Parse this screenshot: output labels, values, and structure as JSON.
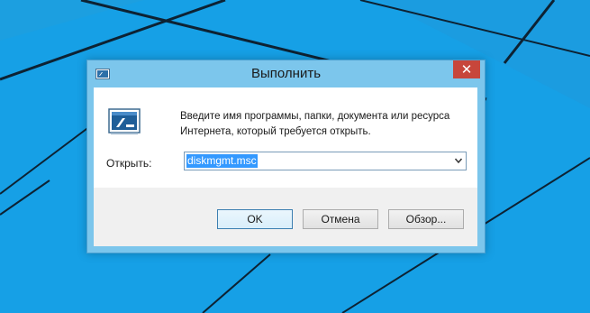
{
  "window": {
    "title": "Выполнить",
    "close_glyph": "✕"
  },
  "dialog": {
    "description": "Введите имя программы, папки, документа или ресурса Интернета, который требуется открыть.",
    "open_label": "Открыть:",
    "command_value": "diskmgmt.msc"
  },
  "buttons": {
    "ok": "OK",
    "cancel": "Отмена",
    "browse": "Обзор..."
  },
  "icons": {
    "title": "run-icon",
    "main": "run-icon",
    "dropdown": "chevron-down-icon",
    "close": "close-icon"
  },
  "colors": {
    "desktop": "#16a0e6",
    "window_frame": "#7cc6ec",
    "close_button": "#c7463b",
    "selection": "#3399ff"
  }
}
